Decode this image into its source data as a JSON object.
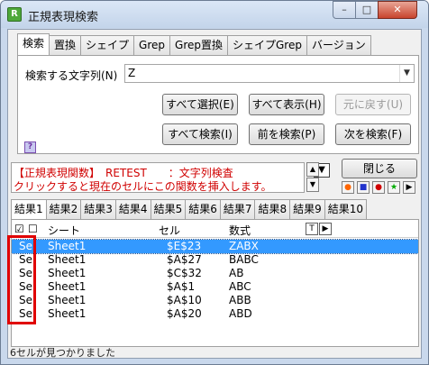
{
  "window": {
    "title": "正規表現検索",
    "minimize_glyph": "–",
    "maximize_glyph": "□",
    "close_glyph": "✕",
    "app_icon_glyph": "R",
    "app_icon_color": "#4ea83a"
  },
  "tabs": [
    {
      "label": "検索",
      "active": true
    },
    {
      "label": "置換"
    },
    {
      "label": "シェイプ"
    },
    {
      "label": "Grep"
    },
    {
      "label": "Grep置換"
    },
    {
      "label": "シェイプGrep"
    },
    {
      "label": "バージョン"
    }
  ],
  "search": {
    "label": "検索する文字列(N)",
    "value": "Z",
    "dropdown_glyph": "▼"
  },
  "buttons": {
    "select_all": "すべて選択(E)",
    "show_all": "すべて表示(H)",
    "undo": "元に戻す(U)",
    "search_all": "すべて検索(I)",
    "find_prev": "前を検索(P)",
    "find_next": "次を検索(F)",
    "close": "閉じる"
  },
  "help_glyph": "?",
  "function_info": {
    "line1": "【正規表現関数】　RETEST　　：文字列検査",
    "line2": "クリックすると現在のセルにこの関数を挿入します。",
    "text_color": "#d00000"
  },
  "spin": {
    "up": "▲",
    "down": "▼",
    "drop": "▼"
  },
  "mini_buttons": [
    {
      "glyph": "●",
      "color": "#ff6600"
    },
    {
      "glyph": "■",
      "color": "#2233cc"
    },
    {
      "glyph": "●",
      "color": "#d00000"
    },
    {
      "glyph": "★",
      "color": "#00aa00"
    },
    {
      "glyph": "▶",
      "color": "#000000"
    }
  ],
  "result_tabs": [
    "結果1",
    "結果2",
    "結果3",
    "結果4",
    "結果5",
    "結果6",
    "結果7",
    "結果8",
    "結果9",
    "結果10"
  ],
  "grid": {
    "check_all": "☑",
    "uncheck_all": "☐",
    "columns": {
      "sheet": "シート",
      "cell": "セル",
      "formula": "数式"
    },
    "filter_glyph": "T",
    "next_glyph": "▶",
    "rows": [
      {
        "sel": "Sel",
        "sheet": "Sheet1",
        "cell": "$E$23",
        "formula": "ZABX",
        "selected": true
      },
      {
        "sel": "Sel",
        "sheet": "Sheet1",
        "cell": "$A$27",
        "formula": "BABC"
      },
      {
        "sel": "Sel",
        "sheet": "Sheet1",
        "cell": "$C$32",
        "formula": "AB"
      },
      {
        "sel": "Sel",
        "sheet": "Sheet1",
        "cell": "$A$1",
        "formula": "ABC"
      },
      {
        "sel": "Sel",
        "sheet": "Sheet1",
        "cell": "$A$10",
        "formula": "ABB"
      },
      {
        "sel": "Sel",
        "sheet": "Sheet1",
        "cell": "$A$20",
        "formula": "ABD"
      }
    ]
  },
  "status": "6セルが見つかりました"
}
